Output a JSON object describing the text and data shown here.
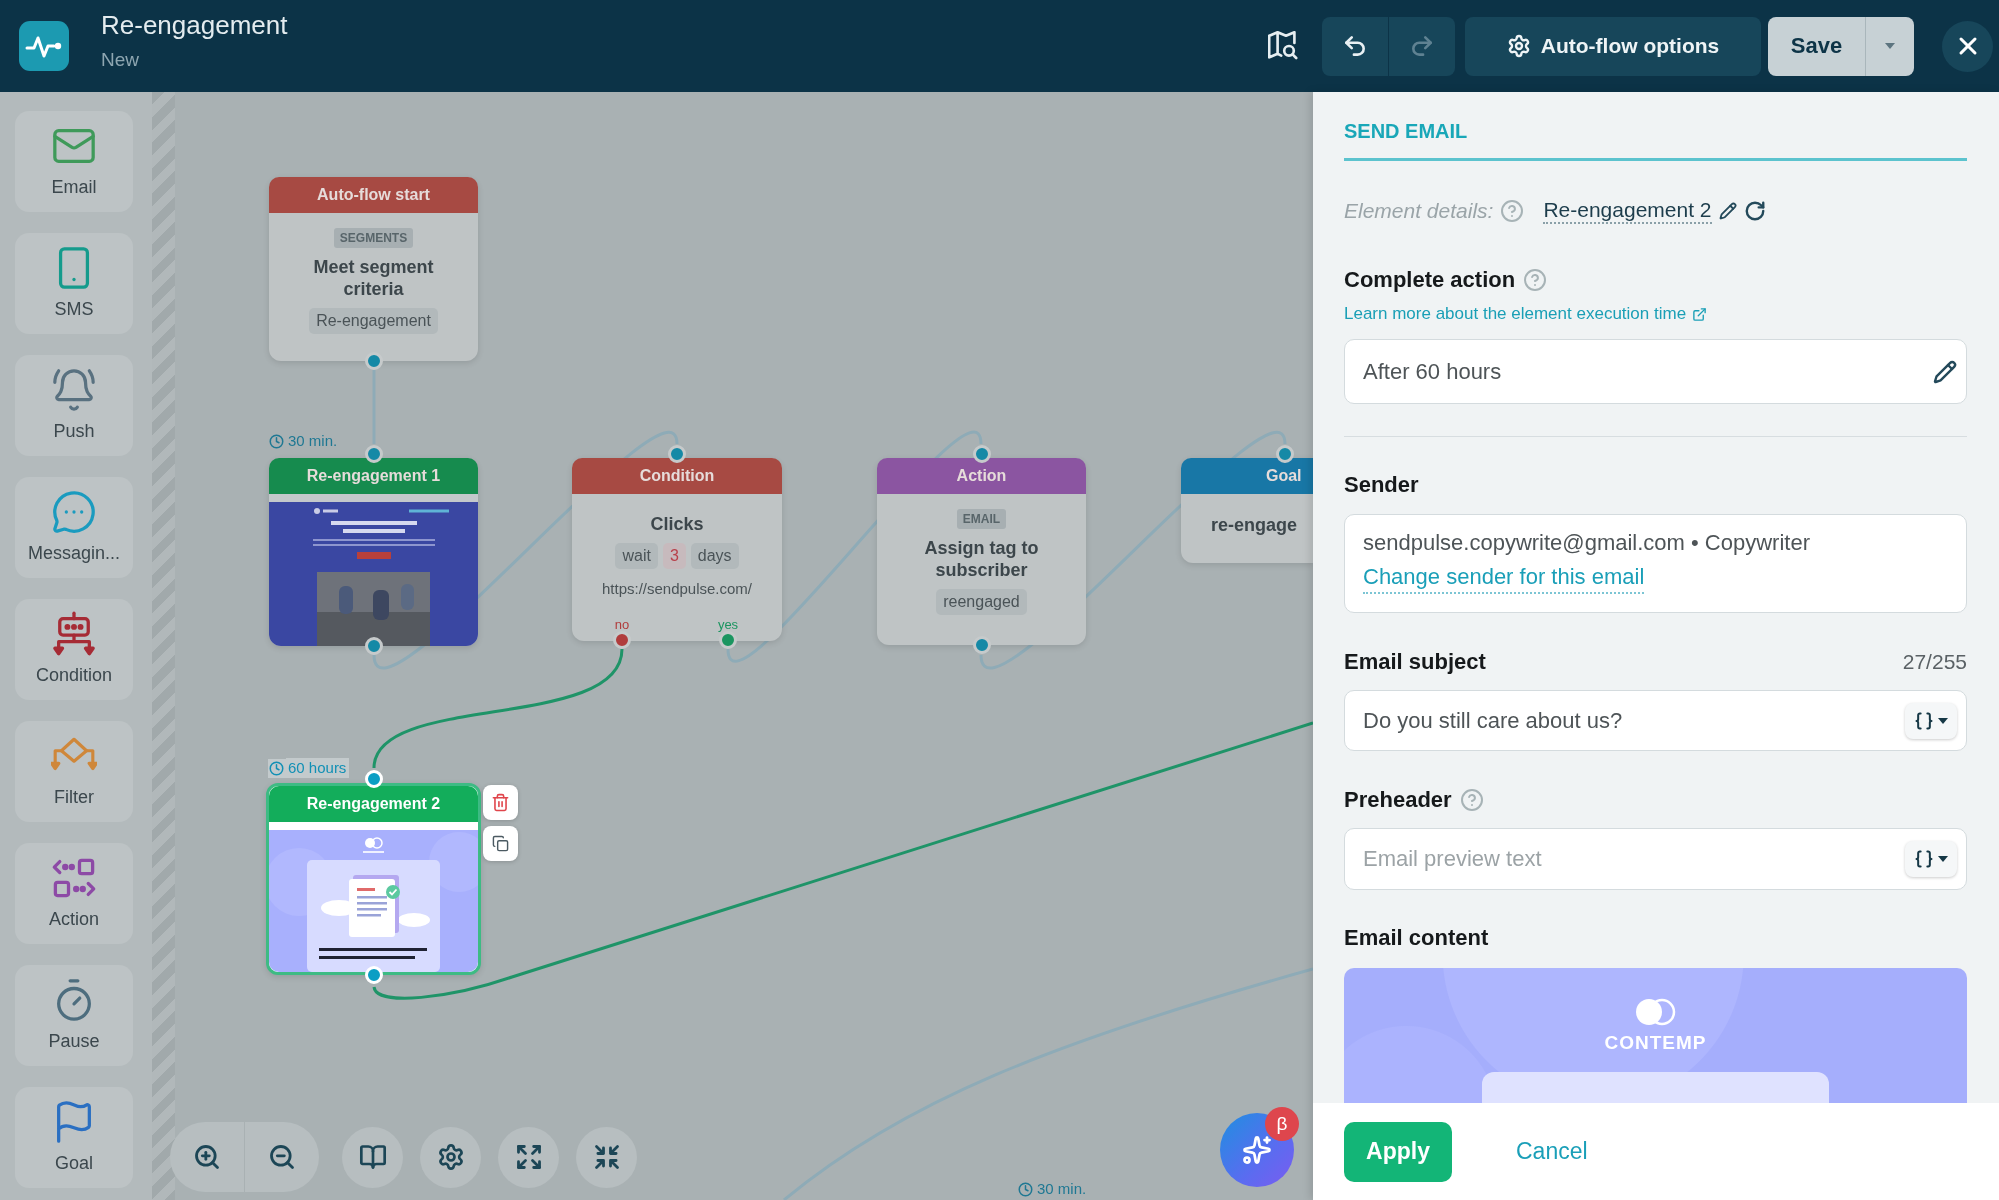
{
  "header": {
    "title": "Re-engagement",
    "status": "New",
    "history": {
      "undo_disabled": false,
      "redo_disabled": true
    },
    "options_button": "Auto-flow options",
    "save_button": "Save"
  },
  "palette": [
    {
      "kind": "email",
      "label": "Email"
    },
    {
      "kind": "sms",
      "label": "SMS"
    },
    {
      "kind": "push",
      "label": "Push"
    },
    {
      "kind": "messaging",
      "label": "Messagin..."
    },
    {
      "kind": "condition",
      "label": "Condition"
    },
    {
      "kind": "filter",
      "label": "Filter"
    },
    {
      "kind": "action",
      "label": "Action"
    },
    {
      "kind": "pause",
      "label": "Pause"
    },
    {
      "kind": "goal",
      "label": "Goal"
    }
  ],
  "canvas": {
    "nodes": [
      {
        "kind": "start",
        "title": "Auto-flow start",
        "tag": "SEGMENTS",
        "text": "Meet segment criteria",
        "chip": "Re-engagement",
        "selected": false
      },
      {
        "kind": "email",
        "title": "Re-engagement 1",
        "preview": {
          "kind": "photo-banner"
        },
        "selected": false
      },
      {
        "kind": "condition",
        "title": "Condition",
        "text": "Clicks",
        "wait": {
          "label": "wait",
          "count": "3",
          "unit": "days"
        },
        "url": "https://sendpulse.com/",
        "outputs": [
          {
            "kind": "negative",
            "label": "no"
          },
          {
            "kind": "positive",
            "label": "yes"
          }
        ],
        "selected": false
      },
      {
        "kind": "action",
        "title": "Action",
        "tag": "EMAIL",
        "text": "Assign tag to subscriber",
        "chip": "reengaged",
        "selected": false
      },
      {
        "kind": "goal",
        "title": "Goal",
        "text": "re-engage",
        "selected": false
      },
      {
        "kind": "email",
        "title": "Re-engagement 2",
        "preview": {
          "kind": "illustration"
        },
        "selected": true
      }
    ],
    "delays": [
      {
        "label": "30 min.",
        "selected": false
      },
      {
        "label": "60 hours",
        "selected": true
      },
      {
        "label": "30 min.",
        "selected": false
      }
    ],
    "assistant": {
      "badge": "β"
    }
  },
  "panel": {
    "title": "SEND EMAIL",
    "details": {
      "label": "Element details:",
      "name": "Re-engagement 2"
    },
    "complete_action": {
      "label": "Complete action",
      "link": "Learn more about the element execution time",
      "value": "After 60 hours"
    },
    "sender": {
      "label": "Sender",
      "address": "sendpulse.copywrite@gmail.com • Copywriter",
      "link": "Change sender for this email"
    },
    "subject": {
      "label": "Email subject",
      "counter": "27/255",
      "value": "Do you still care about us?"
    },
    "preheader": {
      "label": "Preheader",
      "placeholder": "Email preview text"
    },
    "content": {
      "label": "Email content",
      "brand": "CONTEMP"
    },
    "apply_button": "Apply",
    "cancel_button": "Cancel"
  }
}
